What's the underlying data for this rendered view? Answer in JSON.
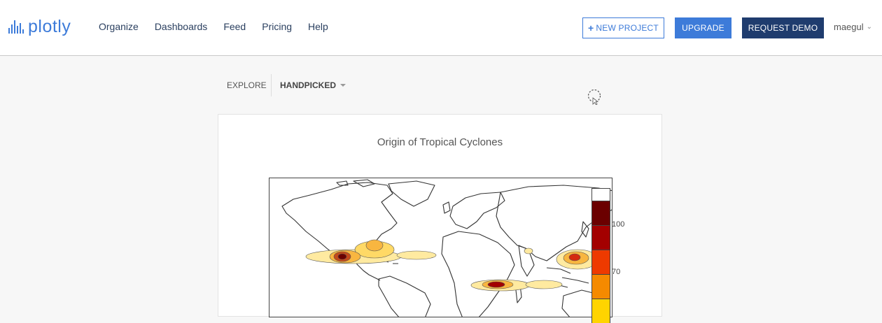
{
  "brand": {
    "name": "plotly",
    "color": "#3d7bd9"
  },
  "nav": {
    "items": [
      "Organize",
      "Dashboards",
      "Feed",
      "Pricing",
      "Help"
    ]
  },
  "buttons": {
    "new_project": "NEW PROJECT",
    "upgrade": "UPGRADE",
    "request_demo": "REQUEST DEMO"
  },
  "user": {
    "name": "maegul"
  },
  "explore": {
    "label": "EXPLORE",
    "filter": "HANDPICKED"
  },
  "chart_data": {
    "type": "heatmap",
    "title": "Origin of Tropical Cyclones",
    "xlabel": "",
    "ylabel": "",
    "colorbar": {
      "tick_labels": [
        "100",
        "70"
      ],
      "colors": [
        "#ffffff",
        "#6b0000",
        "#a30000",
        "#d41010",
        "#ee3a00",
        "#f58a00",
        "#ffd400"
      ]
    }
  },
  "colors": {
    "accent": "#3d7bd9",
    "dark_button": "#1f3c6e"
  }
}
